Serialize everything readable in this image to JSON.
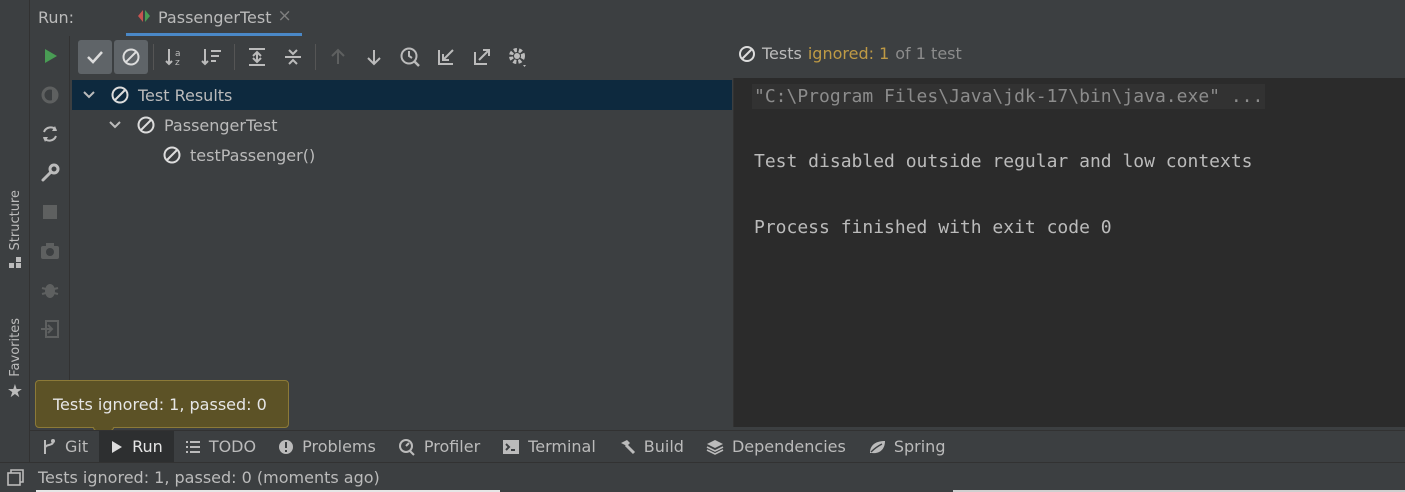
{
  "header": {
    "run_label": "Run:",
    "tab_title": "PassengerTest",
    "close_glyph": "×"
  },
  "side_tabs": {
    "structure": "Structure",
    "favorites": "Favorites"
  },
  "toolbar": {
    "icons": [
      "run-icon",
      "show-passed-icon",
      "show-ignored-icon",
      "sort-alpha-icon",
      "sort-duration-icon",
      "expand-all-icon",
      "collapse-all-icon",
      "prev-failed-icon",
      "next-failed-icon",
      "history-icon",
      "import-icon",
      "export-icon",
      "settings-icon"
    ]
  },
  "status_header": {
    "prefix": "Tests",
    "ignored": "ignored: 1",
    "suffix": "of 1 test"
  },
  "tree": {
    "root": "Test Results",
    "class_node": "PassengerTest",
    "method_node": "testPassenger()"
  },
  "console": {
    "command": "\"C:\\Program Files\\Java\\jdk-17\\bin\\java.exe\" ...",
    "line1": "Test disabled outside regular and low contexts",
    "line2": "Process finished with exit code 0"
  },
  "tooltip": {
    "text": "Tests ignored: 1, passed: 0"
  },
  "bottom_tabs": [
    {
      "label": "Git",
      "icon": "git-branch-icon"
    },
    {
      "label": "Run",
      "icon": "play-icon"
    },
    {
      "label": "TODO",
      "icon": "list-icon"
    },
    {
      "label": "Problems",
      "icon": "info-circle-icon"
    },
    {
      "label": "Profiler",
      "icon": "profiler-icon"
    },
    {
      "label": "Terminal",
      "icon": "terminal-icon"
    },
    {
      "label": "Build",
      "icon": "hammer-icon"
    },
    {
      "label": "Dependencies",
      "icon": "stack-icon"
    },
    {
      "label": "Spring",
      "icon": "spring-leaf-icon"
    }
  ],
  "statusbar": {
    "text": "Tests ignored: 1, passed: 0 (moments ago)"
  },
  "colors": {
    "accent_ignored": "#bf9a45",
    "run_green": "#499c54",
    "selection": "#0d293e",
    "tooltip_bg": "#5c5226"
  }
}
